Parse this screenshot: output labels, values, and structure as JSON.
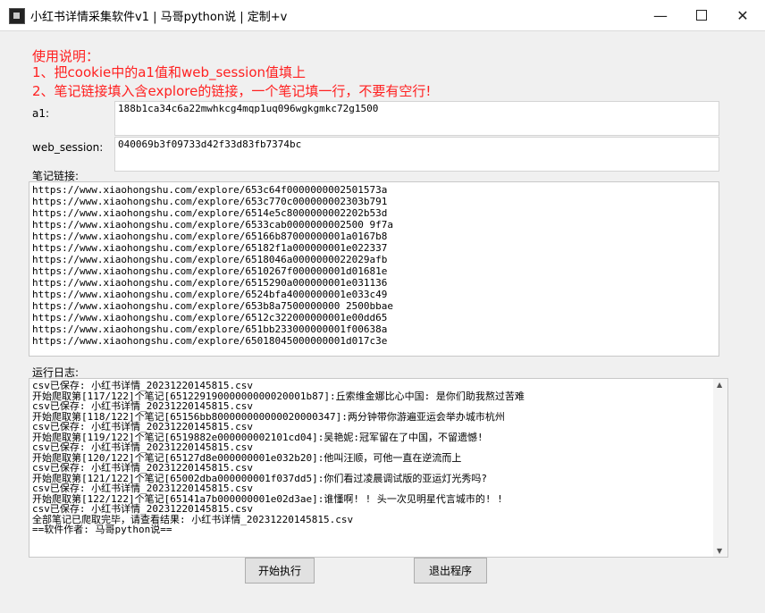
{
  "window": {
    "title": "小红书详情采集软件v1 | 马哥python说 | 定制+v"
  },
  "instructions": {
    "heading": "使用说明：",
    "step1": "1、把cookie中的a1值和web_session值填上",
    "step2": "2、笔记链接填入含explore的链接，一个笔记填一行，不要有空行!"
  },
  "form": {
    "a1_label": "a1:",
    "a1_value": "188b1ca34c6a22mwhkcg4mqp1uq096wgkgmkc72g1500",
    "web_session_label": "web_session:",
    "web_session_value": "040069b3f09733d42f33d83fb7374bc",
    "links_label": "笔记链接:",
    "log_label": "运行日志:"
  },
  "links": [
    "https://www.xiaohongshu.com/explore/653c64f0000000002501573a",
    "https://www.xiaohongshu.com/explore/653c770c000000002303b791",
    "https://www.xiaohongshu.com/explore/6514e5c8000000002202b53d",
    "https://www.xiaohongshu.com/explore/6533cab0000000002500 9f7a",
    "https://www.xiaohongshu.com/explore/65166b87000000001a0167b8",
    "https://www.xiaohongshu.com/explore/65182f1a000000001e022337",
    "https://www.xiaohongshu.com/explore/6518046a0000000022029afb",
    "https://www.xiaohongshu.com/explore/6510267f000000001d01681e",
    "https://www.xiaohongshu.com/explore/6515290a000000001e031136",
    "https://www.xiaohongshu.com/explore/6524bfa4000000001e033c49",
    "https://www.xiaohongshu.com/explore/653b8a7500000000 2500bbae",
    "https://www.xiaohongshu.com/explore/6512c322000000001e00dd65",
    "https://www.xiaohongshu.com/explore/651bb233000000001f00638a",
    "https://www.xiaohongshu.com/explore/65018045000000001d017c3e"
  ],
  "log": [
    "csv已保存: 小红书详情_20231220145815.csv",
    "开始爬取第[117/122]个笔记[65122919000000000020001b87]:丘索维金娜比心中国: 是你们助我熬过苦难",
    "csv已保存: 小红书详情_20231220145815.csv",
    "开始爬取第[118/122]个笔记[65156bb800000000000020000347]:两分钟带你游遍亚运会举办城市杭州",
    "csv已保存: 小红书详情_20231220145815.csv",
    "开始爬取第[119/122]个笔记[6519882e000000002101cd04]:吴艳妮:冠军留在了中国，不留遗憾!",
    "csv已保存: 小红书详情_20231220145815.csv",
    "开始爬取第[120/122]个笔记[65127d8e000000001e032b20]:他叫汪顺，可他一直在逆流而上",
    "csv已保存: 小红书详情_20231220145815.csv",
    "开始爬取第[121/122]个笔记[65002dba000000001f037dd5]:你们看过凌晨调试版的亚运灯光秀吗?",
    "csv已保存: 小红书详情_20231220145815.csv",
    "开始爬取第[122/122]个笔记[65141a7b000000001e02d3ae]:谁懂啊! ! 头一次见明星代言城市的! !",
    "csv已保存: 小红书详情_20231220145815.csv",
    "全部笔记已爬取完毕，请查看结果: 小红书详情_20231220145815.csv",
    "==软件作者: 马哥python说=="
  ],
  "buttons": {
    "start": "开始执行",
    "exit": "退出程序"
  },
  "icons": {
    "minimize": "minimize-icon",
    "maximize": "maximize-icon",
    "close": "close-icon"
  },
  "colors": {
    "instruction_red": "#ff2020"
  }
}
